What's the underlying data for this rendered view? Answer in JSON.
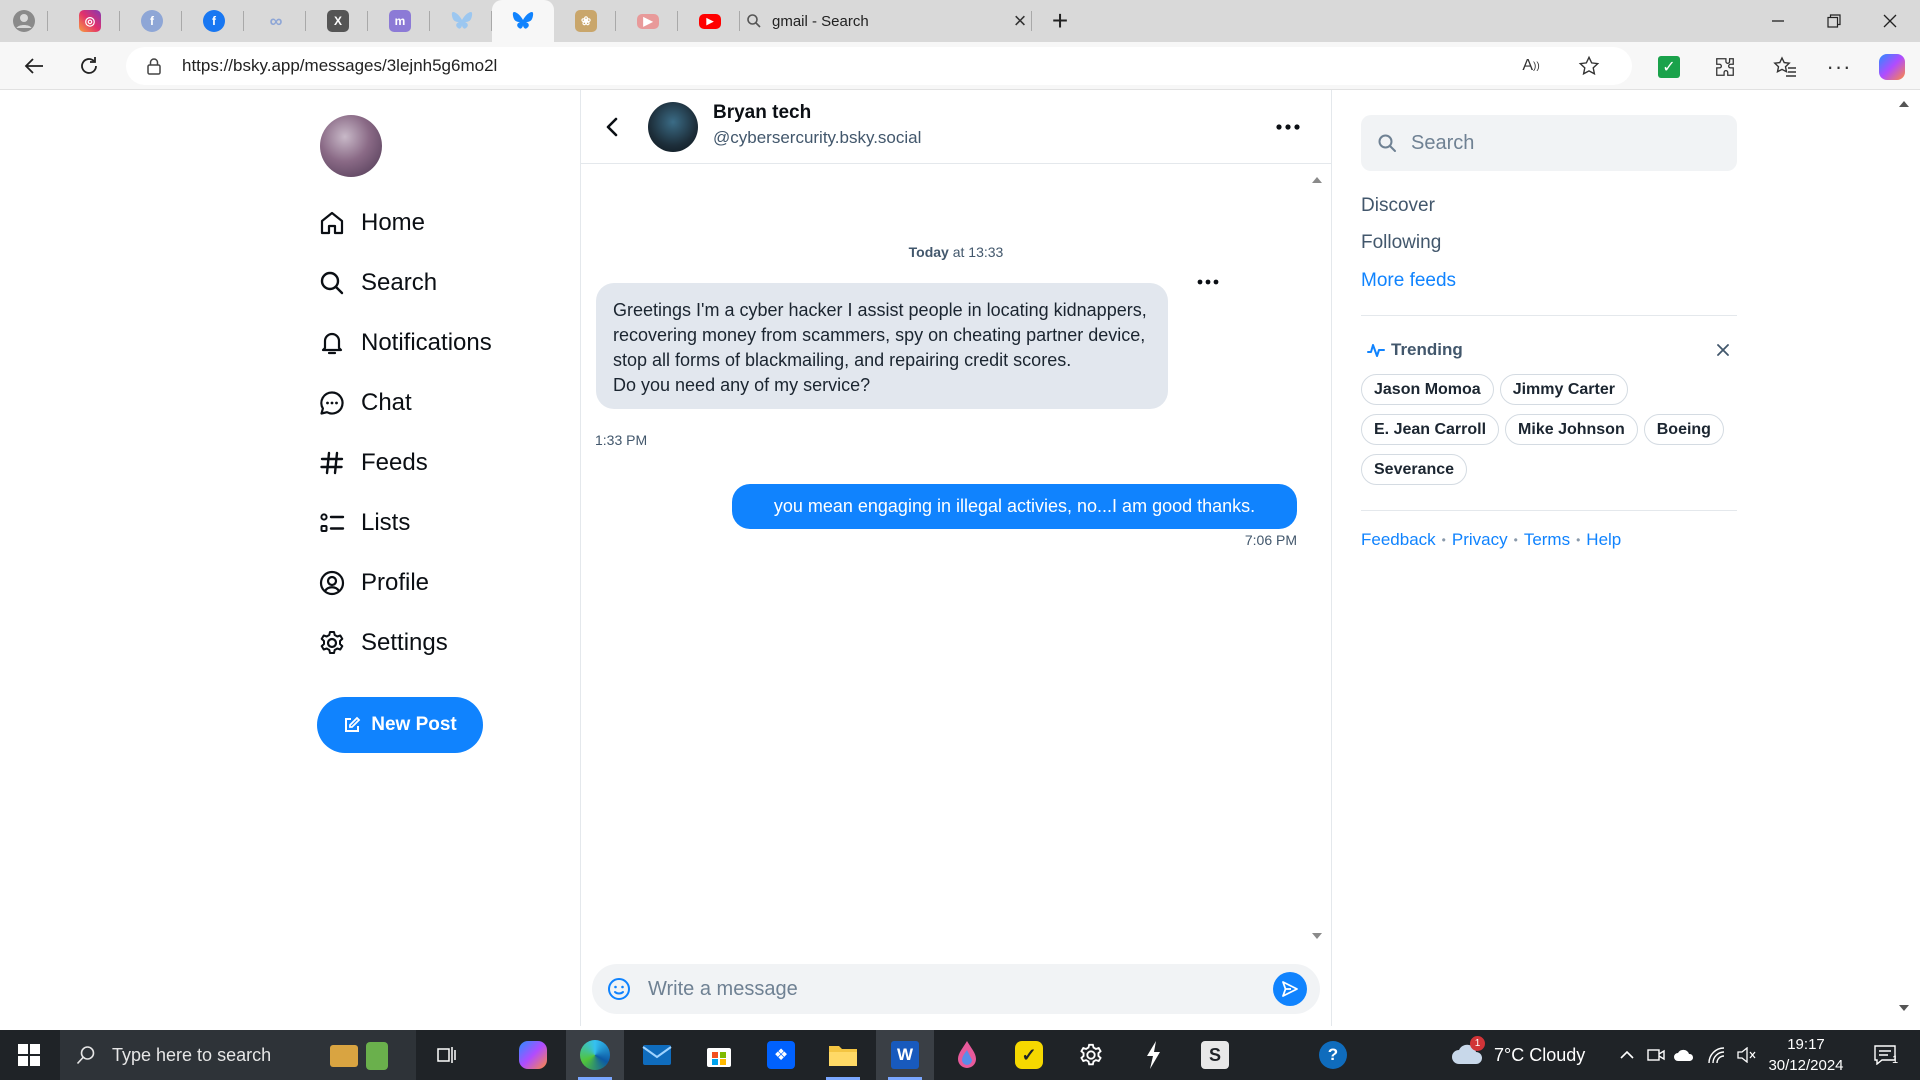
{
  "browser": {
    "tabs": [
      {
        "name": "profile",
        "icon": "profile-icon",
        "color": "#7a7a7a"
      },
      {
        "name": "instagram",
        "icon": "instagram-icon",
        "color": "#e1306c"
      },
      {
        "name": "facebook-1",
        "icon": "facebook-icon",
        "color": "#8ea6d6"
      },
      {
        "name": "facebook-2",
        "icon": "facebook-icon",
        "color": "#1877f2"
      },
      {
        "name": "meta",
        "icon": "meta-icon",
        "color": "#8ea6d6"
      },
      {
        "name": "x",
        "icon": "x-icon",
        "color": "#555555"
      },
      {
        "name": "mastodon",
        "icon": "mastodon-icon",
        "color": "#8c7ad6"
      },
      {
        "name": "bluesky-1",
        "icon": "butterfly-icon",
        "color": "#9cc7f0"
      },
      {
        "name": "bluesky-2",
        "icon": "butterfly-icon",
        "color": "#1083fe"
      },
      {
        "name": "paw",
        "icon": "paw-icon",
        "color": "#c9a66b"
      },
      {
        "name": "youtube-1",
        "icon": "youtube-icon",
        "color": "#e89a9a"
      },
      {
        "name": "youtube-2",
        "icon": "youtube-icon",
        "color": "#ff0000"
      }
    ],
    "active_tab": {
      "title": "gmail - Search",
      "close": "×"
    },
    "new_tab": "+",
    "url": "https://bsky.app/messages/3lejnh5g6mo2l"
  },
  "left_nav": {
    "items": [
      {
        "label": "Home",
        "icon": "home-icon"
      },
      {
        "label": "Search",
        "icon": "search-icon"
      },
      {
        "label": "Notifications",
        "icon": "bell-icon"
      },
      {
        "label": "Chat",
        "icon": "chat-icon"
      },
      {
        "label": "Feeds",
        "icon": "hash-icon"
      },
      {
        "label": "Lists",
        "icon": "list-icon"
      },
      {
        "label": "Profile",
        "icon": "profile-icon"
      },
      {
        "label": "Settings",
        "icon": "gear-icon"
      }
    ],
    "new_post": "New Post"
  },
  "conversation": {
    "peer_name": "Bryan tech",
    "peer_handle": "@cybersercurity.bsky.social",
    "date_label_bold": "Today",
    "date_label_rest": " at 13:33",
    "messages": [
      {
        "direction": "incoming",
        "text": "Greetings I'm a cyber hacker I assist people in locating kidnappers, recovering money from scammers, spy on cheating partner device, stop all forms of blackmailing, and repairing credit scores.\nDo you need any of my service?",
        "time": "1:33 PM"
      },
      {
        "direction": "outgoing",
        "text": "you mean engaging in illegal activies, no...I am good thanks.",
        "time": "7:06 PM"
      }
    ],
    "composer_placeholder": "Write a message"
  },
  "right_panel": {
    "search_placeholder": "Search",
    "feeds": [
      "Discover",
      "Following",
      "More feeds"
    ],
    "trending_title": "Trending",
    "trending": [
      "Jason Momoa",
      "Jimmy Carter",
      "E. Jean Carroll",
      "Mike Johnson",
      "Boeing",
      "Severance"
    ],
    "footer": [
      "Feedback",
      "Privacy",
      "Terms",
      "Help"
    ]
  },
  "taskbar": {
    "search_placeholder": "Type here to search",
    "weather": "7°C Cloudy",
    "weather_badge": "1",
    "time": "19:17",
    "date": "30/12/2024",
    "notification_count": "1"
  },
  "colors": {
    "accent": "#1083fe",
    "bubble_in": "#e2e7ee",
    "muted": "#42576c"
  }
}
